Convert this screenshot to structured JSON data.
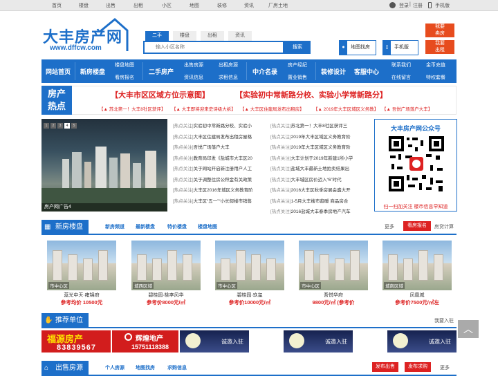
{
  "topbar": {
    "links": [
      "首页",
      "楼盘",
      "出售",
      "出租",
      "小区",
      "地图",
      "装修",
      "资讯",
      "厂房土地"
    ],
    "login": "登录",
    "sep": "|",
    "register": "注册",
    "mobile": "手机版"
  },
  "logo": {
    "title": "大丰房产网",
    "url": "www.dffcw.com"
  },
  "search": {
    "tabs": [
      "二手",
      "楼盘",
      "出租",
      "资讯"
    ],
    "active_tab": 0,
    "placeholder": "输入小区名称",
    "button": "搜索"
  },
  "quick": {
    "map": "地图找房",
    "mobile": "手机版",
    "sell": [
      "我要",
      "卖房"
    ],
    "rent": [
      "我要",
      "出租"
    ]
  },
  "nav": {
    "home": "网站首页",
    "newhouse": "新房楼盘",
    "sub1": [
      "楼盘地图",
      "看房报名"
    ],
    "second": "二手房产",
    "sub2a": [
      "出售房源",
      "资讯信息"
    ],
    "sub2b": [
      "出租房源",
      "求租信息"
    ],
    "agents": "中介名录",
    "sub3": [
      "房产经纪",
      "置业销售"
    ],
    "decor": "装修设计",
    "service": "客服中心",
    "sub4a": [
      "联系我们",
      "在线留言"
    ],
    "sub4b": [
      "金币充值",
      "特权套餐"
    ]
  },
  "hot": {
    "label": [
      "房产",
      "热点"
    ],
    "headline1": "【大丰市区区域方位示意图】",
    "headline2": "【实验初中常新路分校、实验小学常新路分】",
    "small": [
      "【▲ 苏北第一！大丰8社区获评】",
      "【▲ 大丰即将迎来史诗级大拆】",
      "【▲ 大丰区住建局发布出租房】",
      "【▲ 2019年大丰区域区义务教】",
      "【▲ 吾悦广场落户大丰】"
    ]
  },
  "slider": {
    "pages": [
      "1",
      "2",
      "3",
      "4",
      "5"
    ],
    "active": 3,
    "caption": "房产网广告4"
  },
  "news_prefix": "[热点关注]",
  "news_left": [
    "实验初中常新路分校、实验小",
    "大丰区住建局发布出租房屋格",
    "吾悦广场落户大丰",
    "教育局印发《盐城市大丰区20",
    "关于网站开启新注册用户人工",
    "关于调整住房公积金有关政策",
    "大丰区2016年城区义务教育阶",
    "大丰区“五一”“小长假楼市销售"
  ],
  "news_right": [
    "苏北第一！大丰8社区获评三",
    "2019年大丰区域区义务教育阶",
    "2019年大丰区域区义务教育阶",
    "大丰计划于2019年新建1所小学",
    "盐城大丰最新土地拍卖结果出",
    "大丰城区房价迈入“6”时代",
    "2016大丰区秋季房展会盛大开",
    "1-5月大丰楼市趋暖 商品房合",
    "2016盐城大丰春季房地产汽车"
  ],
  "wechat": {
    "title": "大丰房产网公众号",
    "bottom": "扫一扫加关注 楼市信息早知道"
  },
  "newsec": {
    "title": "新房楼盘",
    "links": [
      "新房频道",
      "最新楼盘",
      "特价楼盘",
      "楼盘地图"
    ],
    "more": "更多",
    "signup": "看房报名",
    "calc": "房贷计算"
  },
  "houses": [
    {
      "zone": "市中心区",
      "name": "蓝光中天·雍锦府",
      "price": "参考均价 10500元"
    },
    {
      "zone": "城西区域",
      "name": "碧桂园·桃李风华",
      "price": "参考价8000元/㎡"
    },
    {
      "zone": "市中心区",
      "name": "碧桂园·玖玺",
      "price": "参考价10000元/㎡"
    },
    {
      "zone": "市中心区",
      "name": "吾悦华府",
      "price": "9800元/㎡ (参考价"
    },
    {
      "zone": "城南区域",
      "name": "凤凰城",
      "price": "参考价7500元/㎡左"
    }
  ],
  "recommend": {
    "title": "推荐单位",
    "join": "我要入驻",
    "ads": [
      {
        "name": "福源房产",
        "phone": "83839567"
      },
      {
        "name": "辉煌地产",
        "phone": "15751118388"
      },
      {
        "text": "诚邀入驻"
      },
      {
        "text": "诚邀入驻"
      },
      {
        "text": "诚邀入驻"
      }
    ]
  },
  "salesec": {
    "title": "出售房源",
    "links": [
      "个人房源",
      "地图找房",
      "求购信息"
    ],
    "pub1": "发布出售",
    "pub2": "发布求购",
    "more": "更多"
  },
  "backtop": "︿"
}
